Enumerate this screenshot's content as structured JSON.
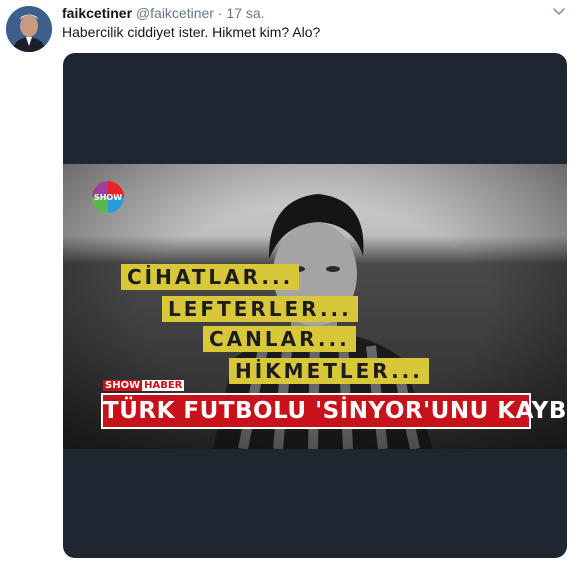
{
  "tweet": {
    "name": "faikcetiner",
    "handle": "@faikcetiner",
    "separator": "·",
    "time": "17 sa.",
    "text": "Habercilik ciddiyet ister. Hikmet kim? Alo?"
  },
  "media": {
    "lines": [
      "CİHATLAR...",
      "LEFTERLER...",
      "CANLAR...",
      "HİKMETLER..."
    ],
    "tag_part1": "SHOW",
    "tag_part2": "HABER",
    "headline": "TÜRK FUTBOLU 'SİNYOR'UNU KAYBETTİ!",
    "logo_text": "SHOW"
  },
  "colors": {
    "name": "#14171a",
    "muted": "#657786",
    "media_bg": "#1e2731",
    "banner": "#c8121b",
    "highlight": "#d9c73a"
  }
}
